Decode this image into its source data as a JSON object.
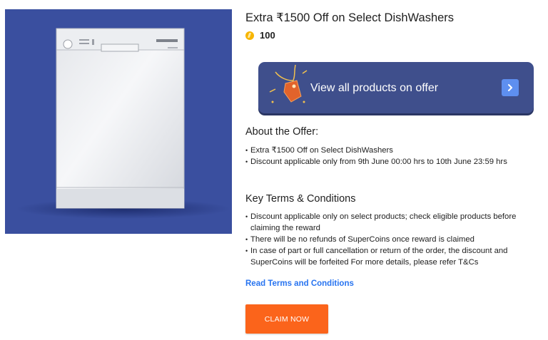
{
  "offer": {
    "title": "Extra ₹1500 Off on Select DishWashers",
    "supercoins": "100",
    "product_image": "dishwasher-image"
  },
  "banner": {
    "label": "View all products on offer",
    "icon": "chevron-right-icon"
  },
  "about": {
    "heading": "About the Offer:",
    "items": [
      "Extra ₹1500 Off on Select DishWashers",
      "Discount applicable only from 9th June 00:00 hrs to 10th June 23:59 hrs"
    ]
  },
  "terms": {
    "heading": "Key Terms & Conditions",
    "items": [
      "Discount applicable only on select products; check eligible products before",
      "claiming the reward",
      "There will be no refunds of SuperCoins once reward is claimed",
      "In case of part or full cancellation or return of the order, the discount and",
      "SuperCoins will be forfeited For more details, please refer T&Cs"
    ],
    "link_label": "Read Terms and Conditions"
  },
  "actions": {
    "claim_label": "CLAIM NOW"
  },
  "colors": {
    "image_background": "#3a4f9f",
    "banner_background": "#3f4f8c",
    "link": "#2874f0",
    "claim_button": "#fb641b",
    "coin": "#f7b500"
  }
}
